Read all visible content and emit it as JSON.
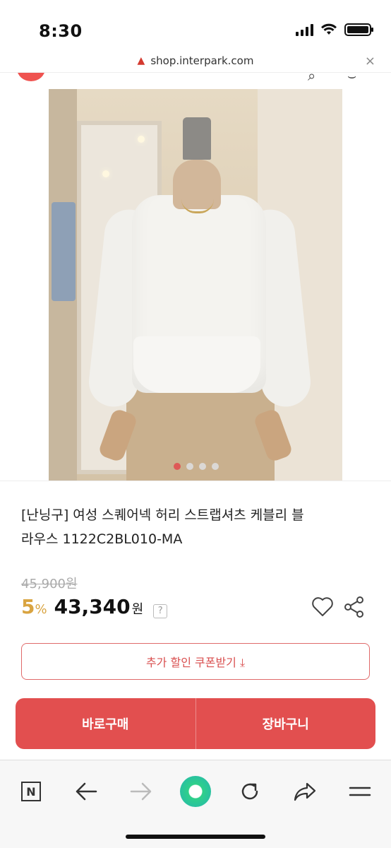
{
  "status_bar": {
    "time": "8:30"
  },
  "browser": {
    "url": "shop.interpark.com",
    "close_label": "×"
  },
  "product": {
    "title_line1": "[난닝구] 여성 스퀘어넥 허리 스트랩셔츠 케블리 블",
    "title_line2": "라우스 1122C2BL010-MA",
    "original_price": "45,900원",
    "discount_value": "5",
    "discount_unit": "%",
    "sale_price_value": "43,340",
    "sale_price_unit": "원",
    "help_label": "?",
    "image_pages": 4,
    "active_image_page": 1
  },
  "actions": {
    "coupon_label": "추가 할인 쿠폰받기 ⤓",
    "buy_now_label": "바로구매",
    "cart_label": "장바구니"
  },
  "toolbar": {
    "icons": [
      "naver-icon",
      "back-icon",
      "forward-icon",
      "green-dot-icon",
      "reload-icon",
      "share-icon",
      "menu-icon"
    ]
  },
  "colors": {
    "accent": "#e24f4f",
    "discount": "#d9a441",
    "coupon_border": "#e06a6a"
  }
}
